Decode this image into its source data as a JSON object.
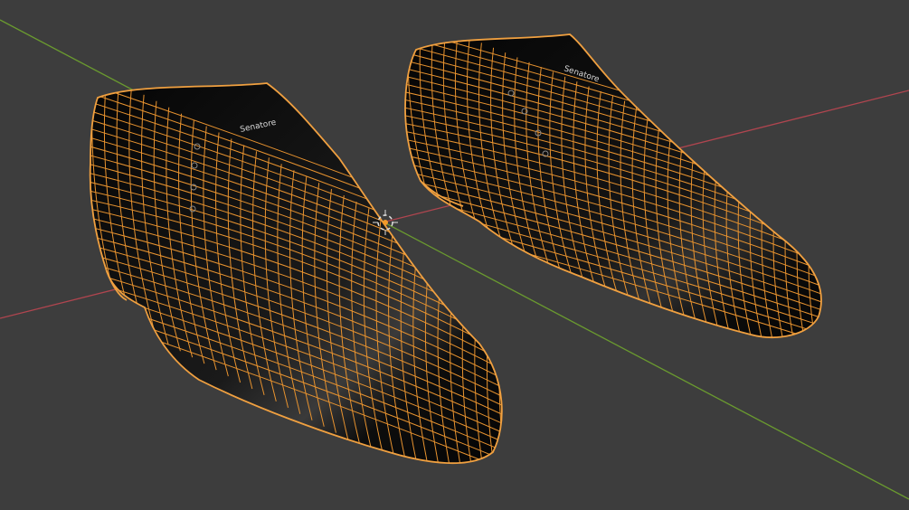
{
  "viewport": {
    "background": "#3d3d3d",
    "axis_x_color": "#b0454f",
    "axis_y_color": "#6a9a2f",
    "wire_color": "#e8932f",
    "mesh_fill_color": "#0b0b0b"
  },
  "objects": [
    {
      "label": "Senatore"
    },
    {
      "label": "Senatore"
    }
  ],
  "icons": {
    "origin": "3d-cursor-icon"
  }
}
